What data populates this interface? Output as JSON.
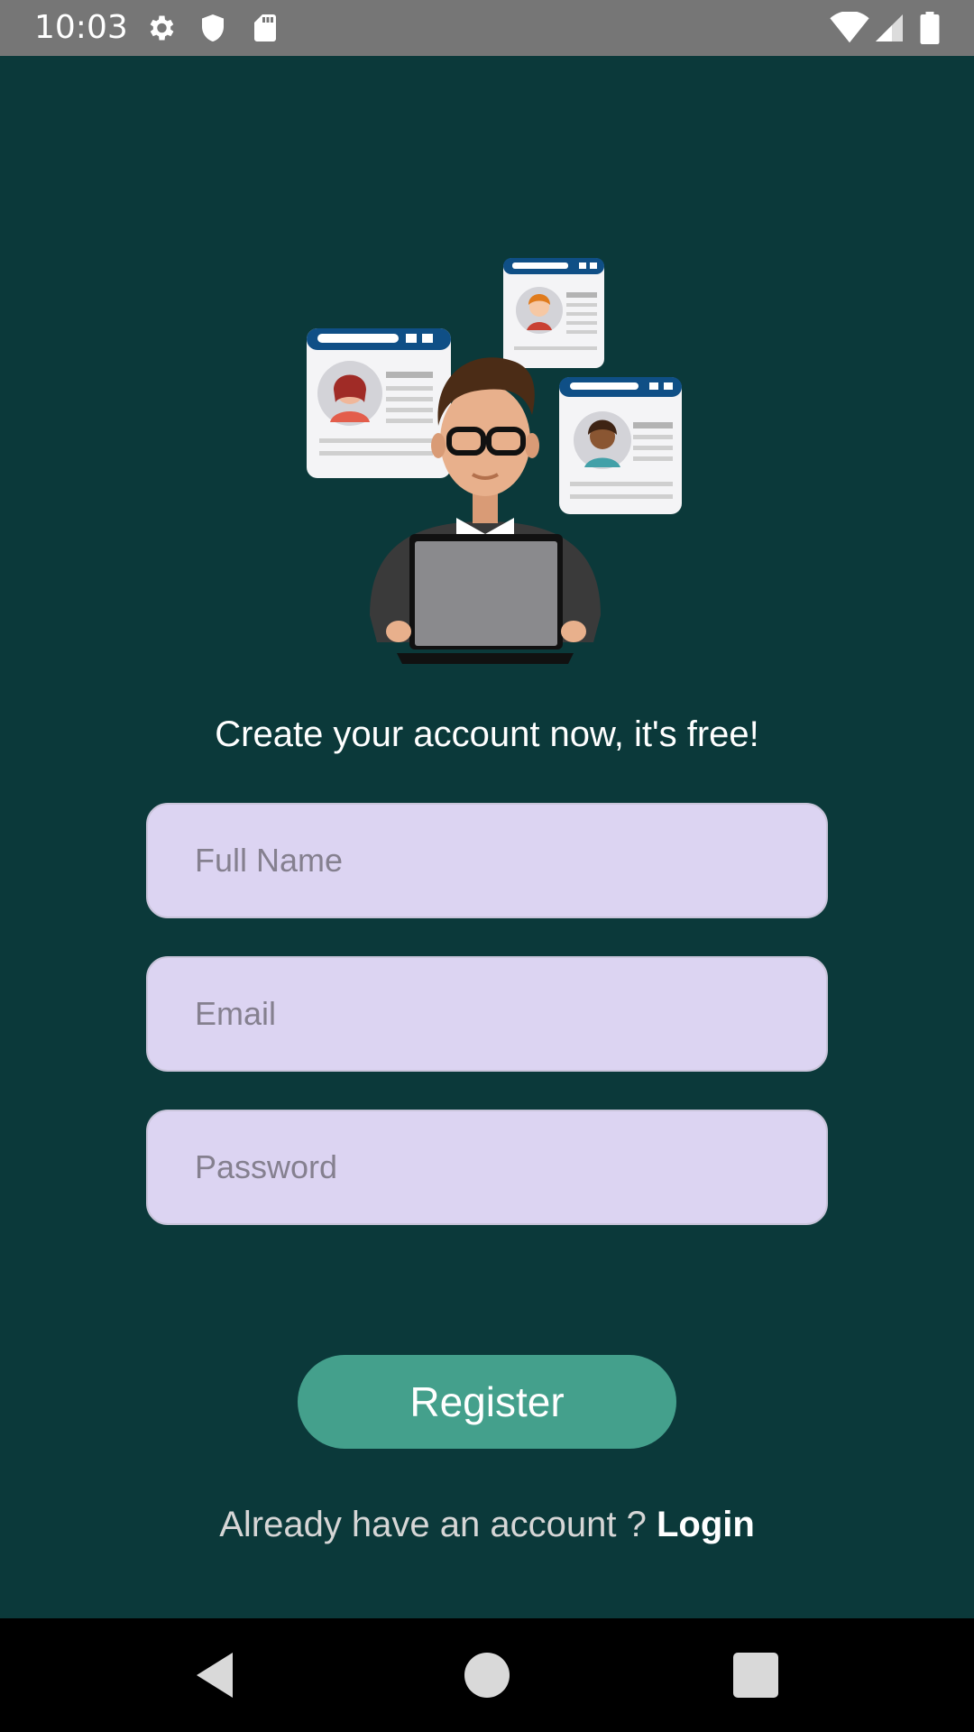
{
  "status_bar": {
    "time": "10:03",
    "icons_left": [
      "gear-icon",
      "shield-icon",
      "sd-card-icon"
    ],
    "icons_right": [
      "wifi-icon",
      "signal-icon",
      "battery-icon"
    ]
  },
  "illustration": {
    "description_icon": "illustration-icon"
  },
  "headline": "Create your account now, it's free!",
  "form": {
    "full_name_placeholder": "Full Name",
    "email_placeholder": "Email",
    "password_placeholder": "Password",
    "register_label": "Register"
  },
  "login_prompt": {
    "text": "Already have an account ? ",
    "link": "Login"
  },
  "colors": {
    "background": "#0b393a",
    "field_fill": "#dcd4f2",
    "button": "#44a08c",
    "status_bar": "#767676"
  },
  "nav_bar": {
    "buttons": [
      "back-icon",
      "home-icon",
      "recents-icon"
    ]
  }
}
